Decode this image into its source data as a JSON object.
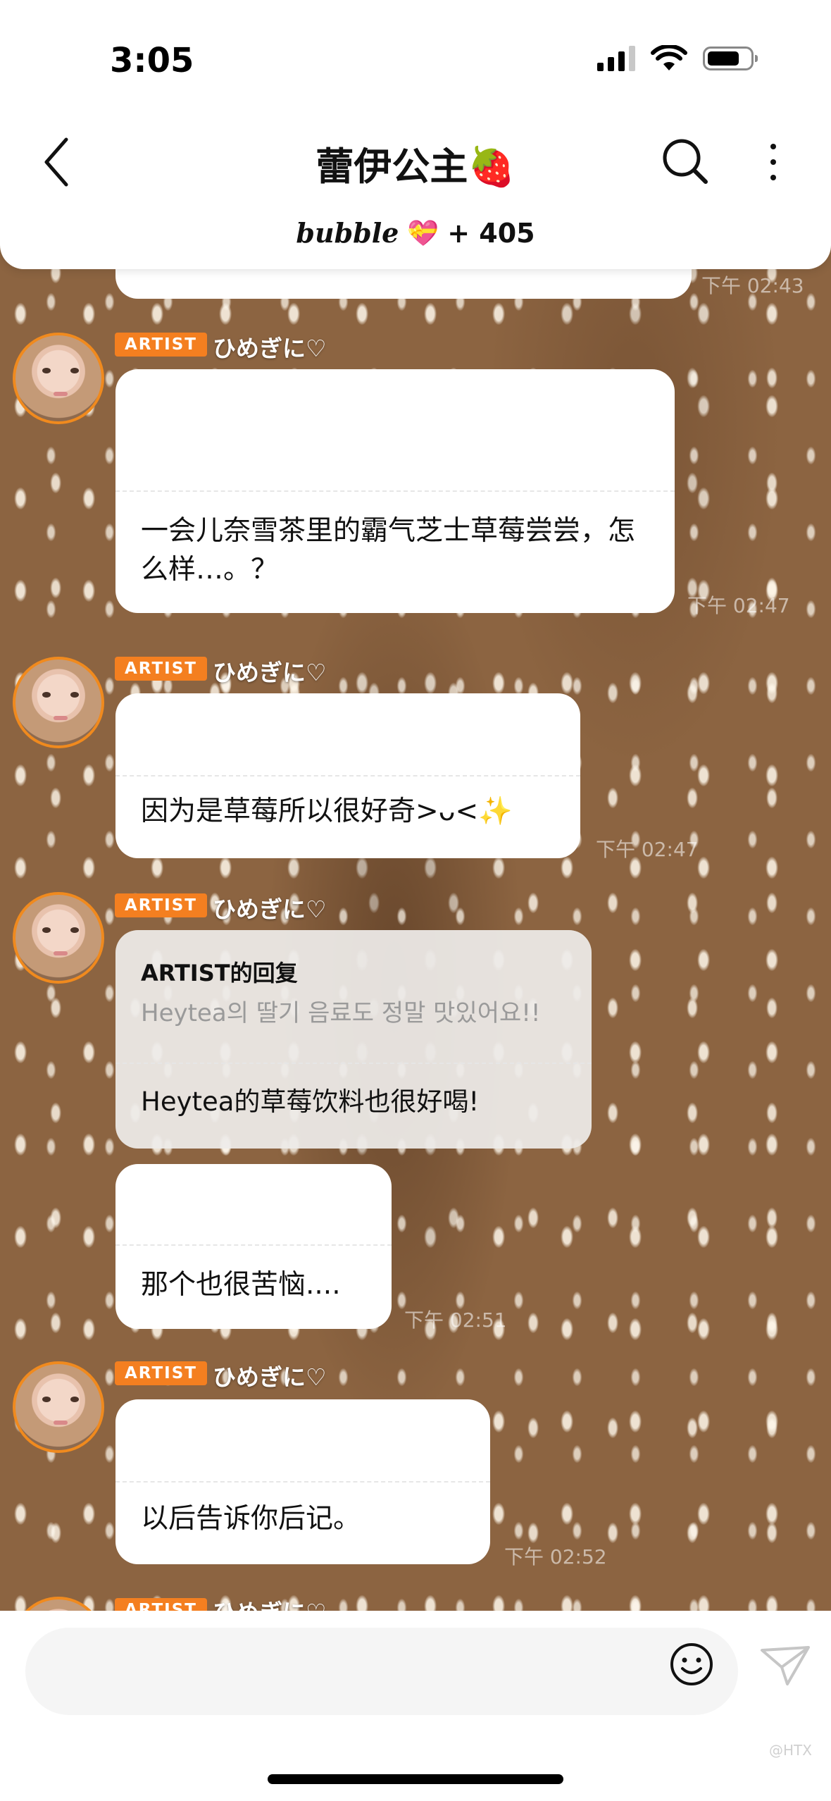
{
  "status_bar": {
    "time": "3:05"
  },
  "header": {
    "title": "蕾伊公主🍓",
    "bubble_logo": "bubble",
    "bubble_heart": "💝",
    "bubble_count": "+ 405"
  },
  "messages": [
    {
      "time": "下午 02:43"
    },
    {
      "tag": "ARTIST",
      "sender": "ひめぎに♡",
      "text": "一会儿奈雪茶里的霸气芝士草莓尝尝，怎么样…。？",
      "time": "下午 02:47"
    },
    {
      "tag": "ARTIST",
      "sender": "ひめぎに♡",
      "text": "因为是草莓所以很好奇>ᴗ<✨",
      "time": "下午 02:47"
    },
    {
      "tag": "ARTIST",
      "sender": "ひめぎに♡",
      "reply_head": "ARTIST的回复",
      "reply_quote": "Heytea의 딸기 음료도 정말 맛있어요!!",
      "text": "Heytea的草莓饮料也很好喝!"
    },
    {
      "text": "那个也很苦恼....",
      "time": "下午 02:51"
    },
    {
      "tag": "ARTIST",
      "sender": "ひめぎに♡",
      "text": "以后告诉你后记。",
      "time": "下午 02:52"
    },
    {
      "tag": "ARTIST",
      "sender": "ひめぎに♡"
    }
  ],
  "input": {
    "placeholder": ""
  },
  "watermark": "@HTX",
  "colors": {
    "accent": "#f47f20",
    "fur": "#8c6441"
  },
  "icons": [
    "back-icon",
    "search-icon",
    "more-icon",
    "emoji-icon",
    "send-icon"
  ]
}
